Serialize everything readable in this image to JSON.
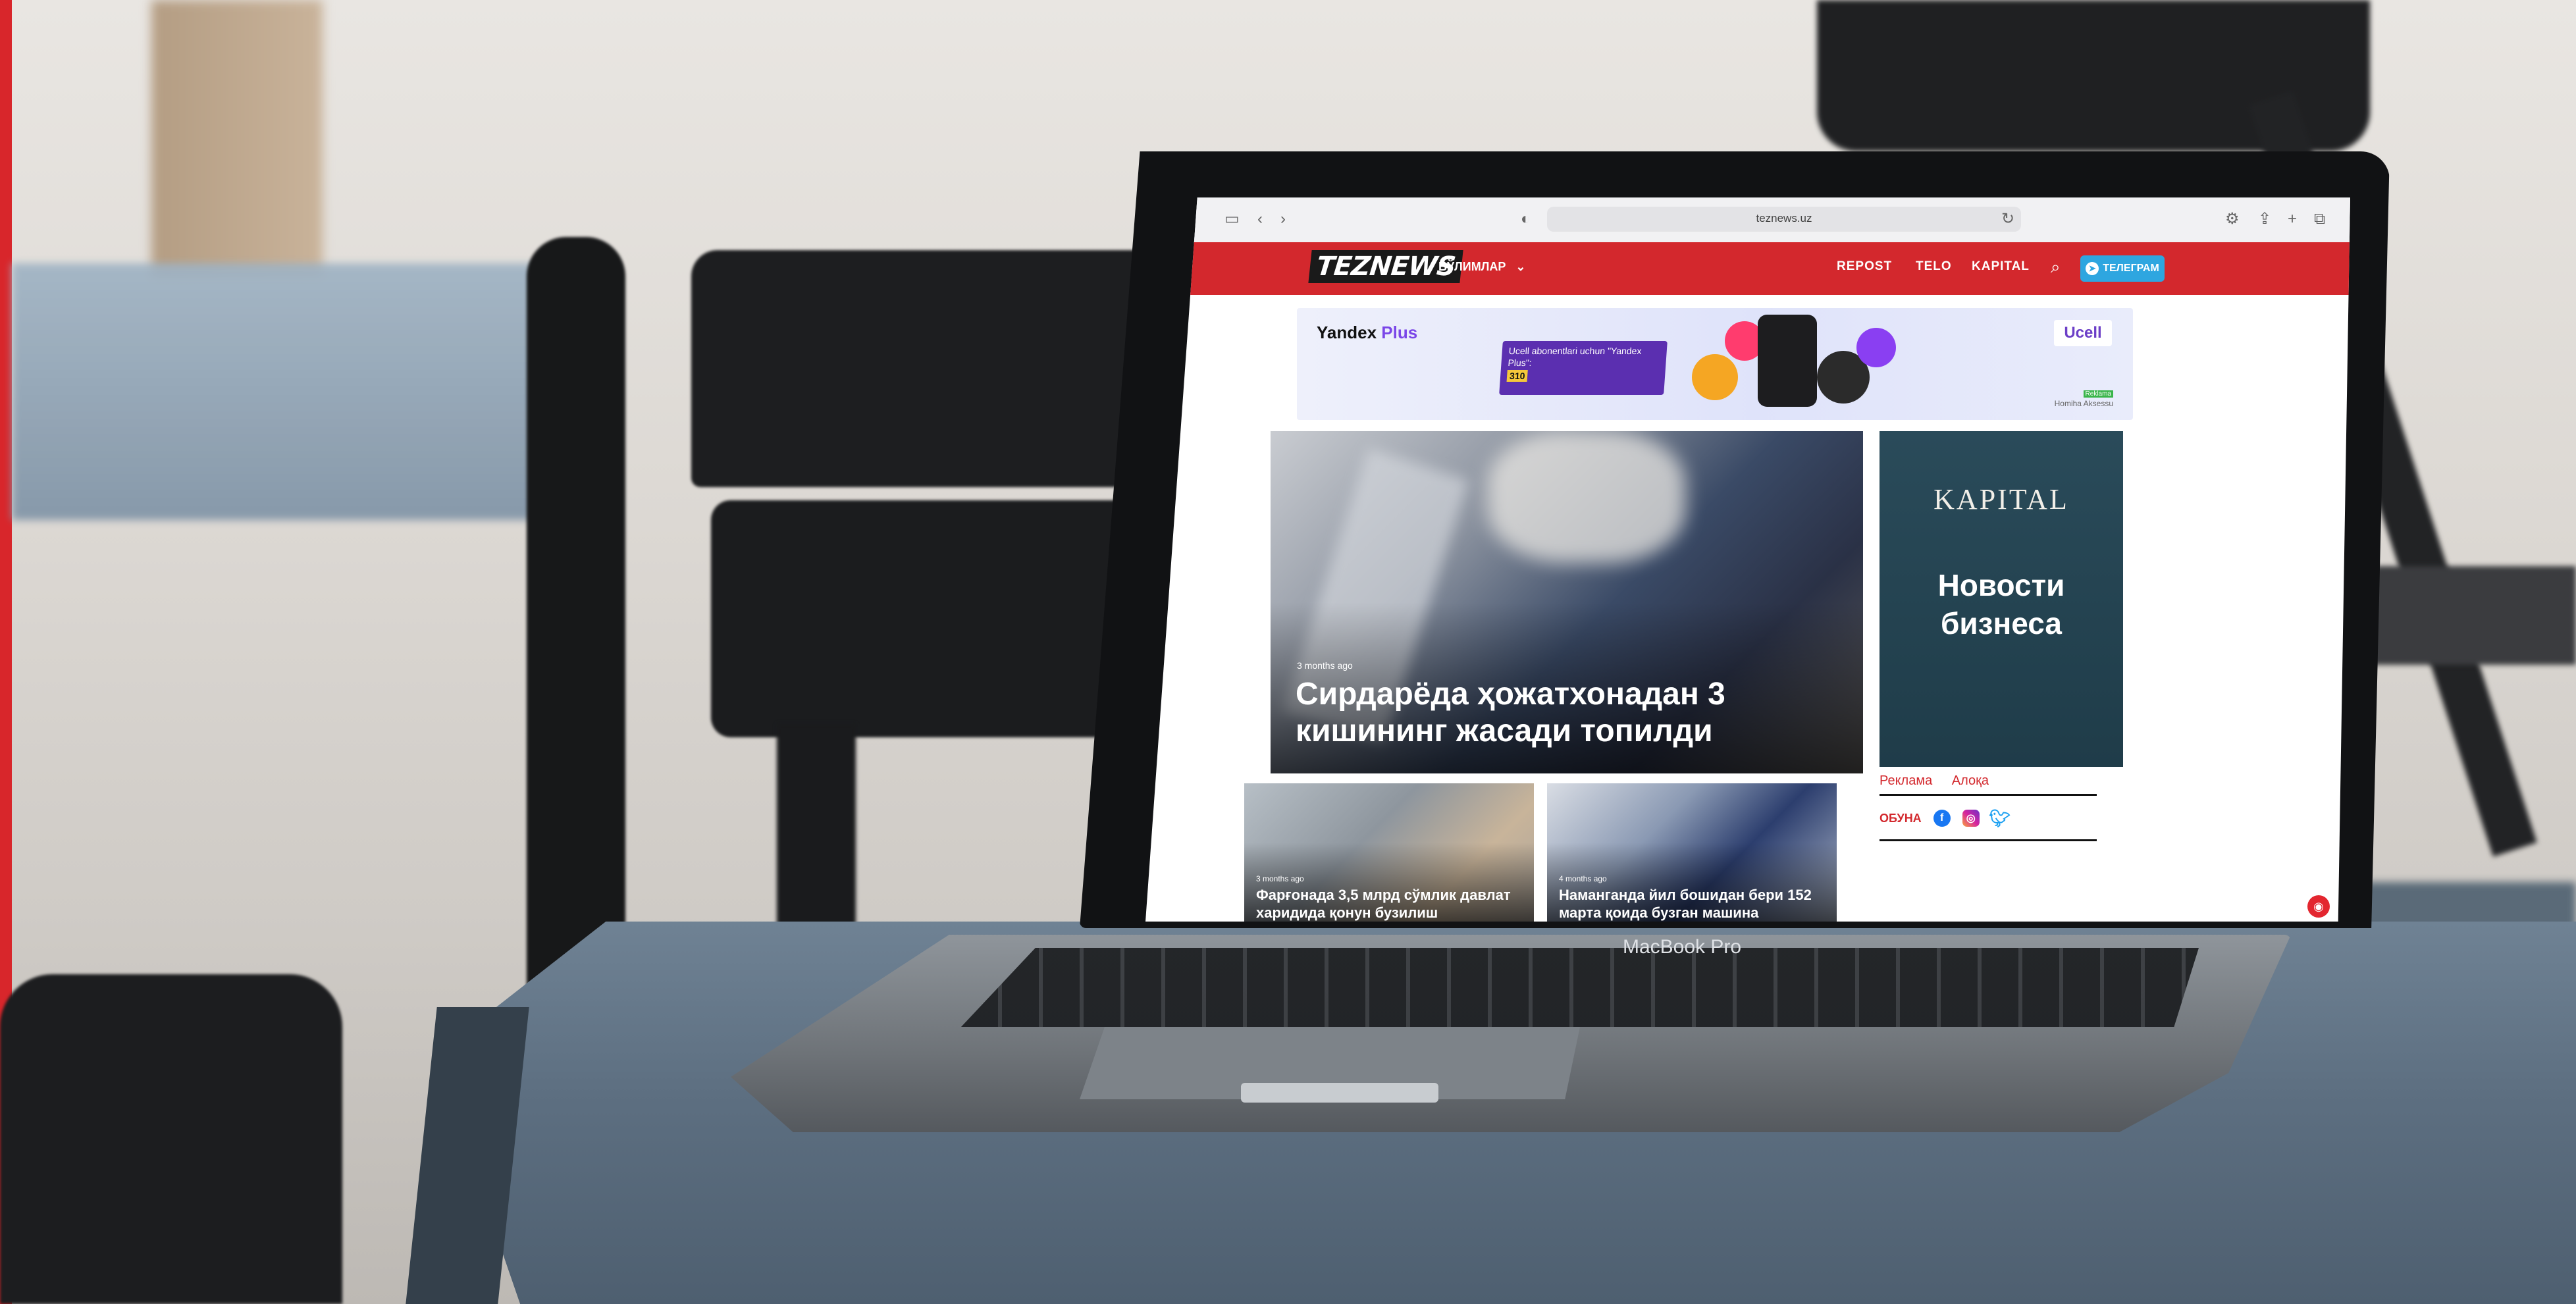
{
  "browser": {
    "url": "teznews.uz",
    "sidebar_icon": "sidebar-icon",
    "back_glyph": "‹",
    "forward_glyph": "›",
    "privacy_glyph": "◐",
    "reload_glyph": "↻",
    "share_glyph": "⇪",
    "newtab_glyph": "+",
    "tabs_glyph": "⧉",
    "extension_glyph": "⚙"
  },
  "site": {
    "logo": "TEZNEWS",
    "sections_label": "БЎЛИМЛАР",
    "sections_chevron": "⌄",
    "nav": [
      "REPOST",
      "TELO",
      "KAPITAL"
    ],
    "search_glyph": "⌕",
    "telegram_label": "ТЕЛЕГРАМ",
    "telegram_glyph": "➤",
    "accent_color": "#d3282d"
  },
  "ad_banner": {
    "brand": "Yandex",
    "brand_plus": "Plus",
    "promo_text": "Ucell abonentlari uchun \"Yandex Plus\":",
    "promo_price": "310",
    "operator": "Ucell",
    "small_label": "Reklama",
    "small_text": "Homiha Aksessu"
  },
  "hero": {
    "time": "3 months ago",
    "title": "Сирдарёда ҳожатхонадан 3 кишининг жасади топилди"
  },
  "side_ad": {
    "logo": "KAPITAL",
    "tagline": "Новости бизнеса"
  },
  "sidebar": {
    "links": [
      "Реклама",
      "Алоқа"
    ],
    "subscribe_label": "ОБУНА",
    "social": [
      "facebook-icon",
      "instagram-icon",
      "twitter-icon"
    ]
  },
  "cards": [
    {
      "time": "3 months ago",
      "title": "Фарғонада 3,5 млрд сўмлик давлат харидида қонун бузилиш"
    },
    {
      "time": "4 months ago",
      "title": "Наманганда йил бошидан бери 152 марта қоида бузган машина"
    }
  ],
  "device_label": "MacBook Pro",
  "help_glyph": "◉"
}
